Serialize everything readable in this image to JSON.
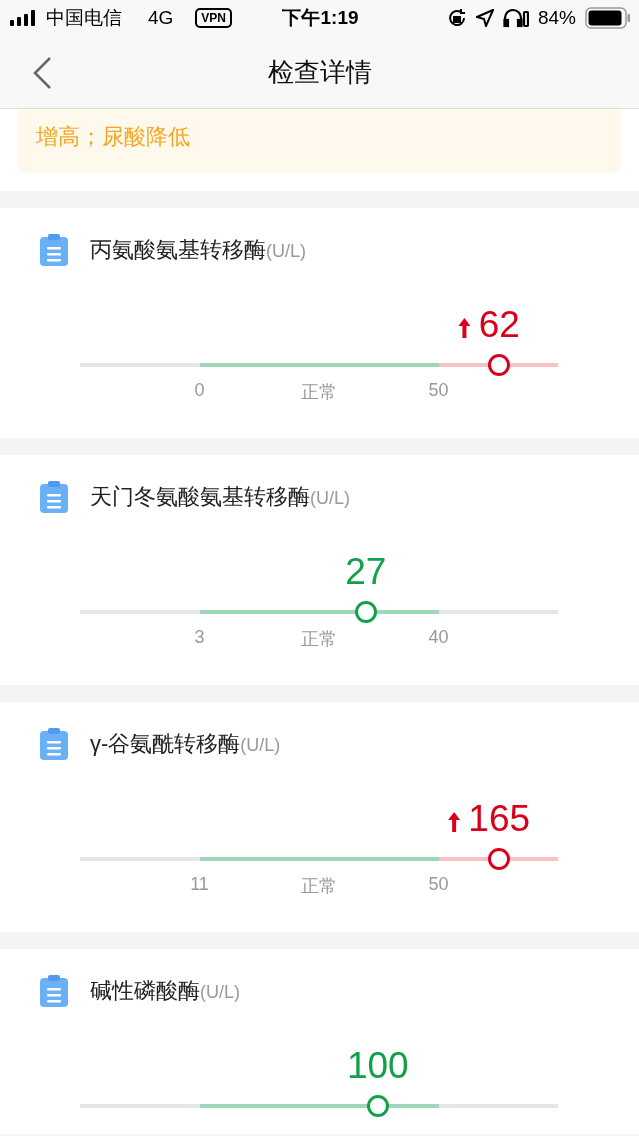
{
  "status_bar": {
    "carrier": "中国电信",
    "network": "4G",
    "vpn": "VPN",
    "time": "下午1:19",
    "battery": "84%"
  },
  "nav": {
    "title": "检查详情"
  },
  "alert": {
    "text": "增高；尿酸降低"
  },
  "items": [
    {
      "name": "丙氨酸氨基转移酶",
      "unit": "(U/L)",
      "value": "62",
      "high": true,
      "level": 0.877,
      "low_limit": "0",
      "range_label": "正常",
      "high_limit": "50"
    },
    {
      "name": "天门冬氨酸氨基转移酶",
      "unit": "(U/L)",
      "value": "27",
      "high": false,
      "level": 0.598,
      "low_limit": "3",
      "range_label": "正常",
      "high_limit": "40"
    },
    {
      "name": "γ-谷氨酰转移酶",
      "unit": "(U/L)",
      "value": "165",
      "high": true,
      "level": 0.877,
      "low_limit": "11",
      "range_label": "正常",
      "high_limit": "50"
    },
    {
      "name": "碱性磷酸酶",
      "unit": "(U/L)",
      "value": "100",
      "high": false,
      "level": 0.623
    }
  ]
}
